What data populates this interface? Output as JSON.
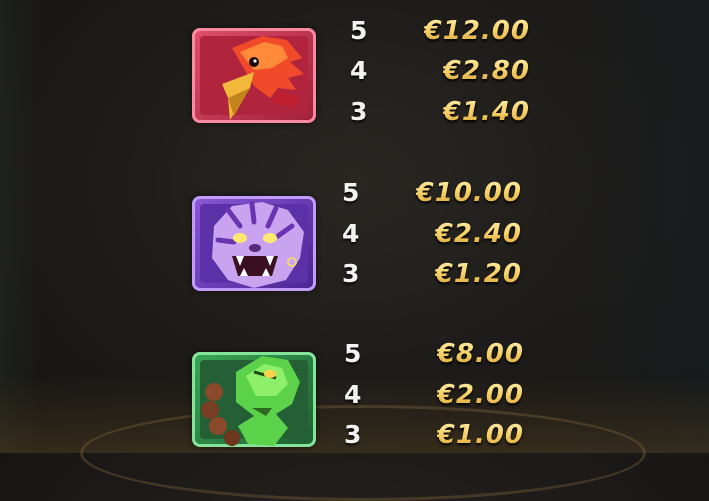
{
  "paytable": [
    {
      "symbol": "bird-icon",
      "color": "#c8304e",
      "payouts": [
        {
          "count": "5",
          "amount": "€12.00"
        },
        {
          "count": "4",
          "amount": "€2.80"
        },
        {
          "count": "3",
          "amount": "€1.40"
        }
      ]
    },
    {
      "symbol": "tiger-icon",
      "color": "#7a45c9",
      "payouts": [
        {
          "count": "5",
          "amount": "€10.00"
        },
        {
          "count": "4",
          "amount": "€2.40"
        },
        {
          "count": "3",
          "amount": "€1.20"
        }
      ]
    },
    {
      "symbol": "snake-icon",
      "color": "#2e8a47",
      "payouts": [
        {
          "count": "5",
          "amount": "€8.00"
        },
        {
          "count": "4",
          "amount": "€2.00"
        },
        {
          "count": "3",
          "amount": "€1.00"
        }
      ]
    }
  ]
}
